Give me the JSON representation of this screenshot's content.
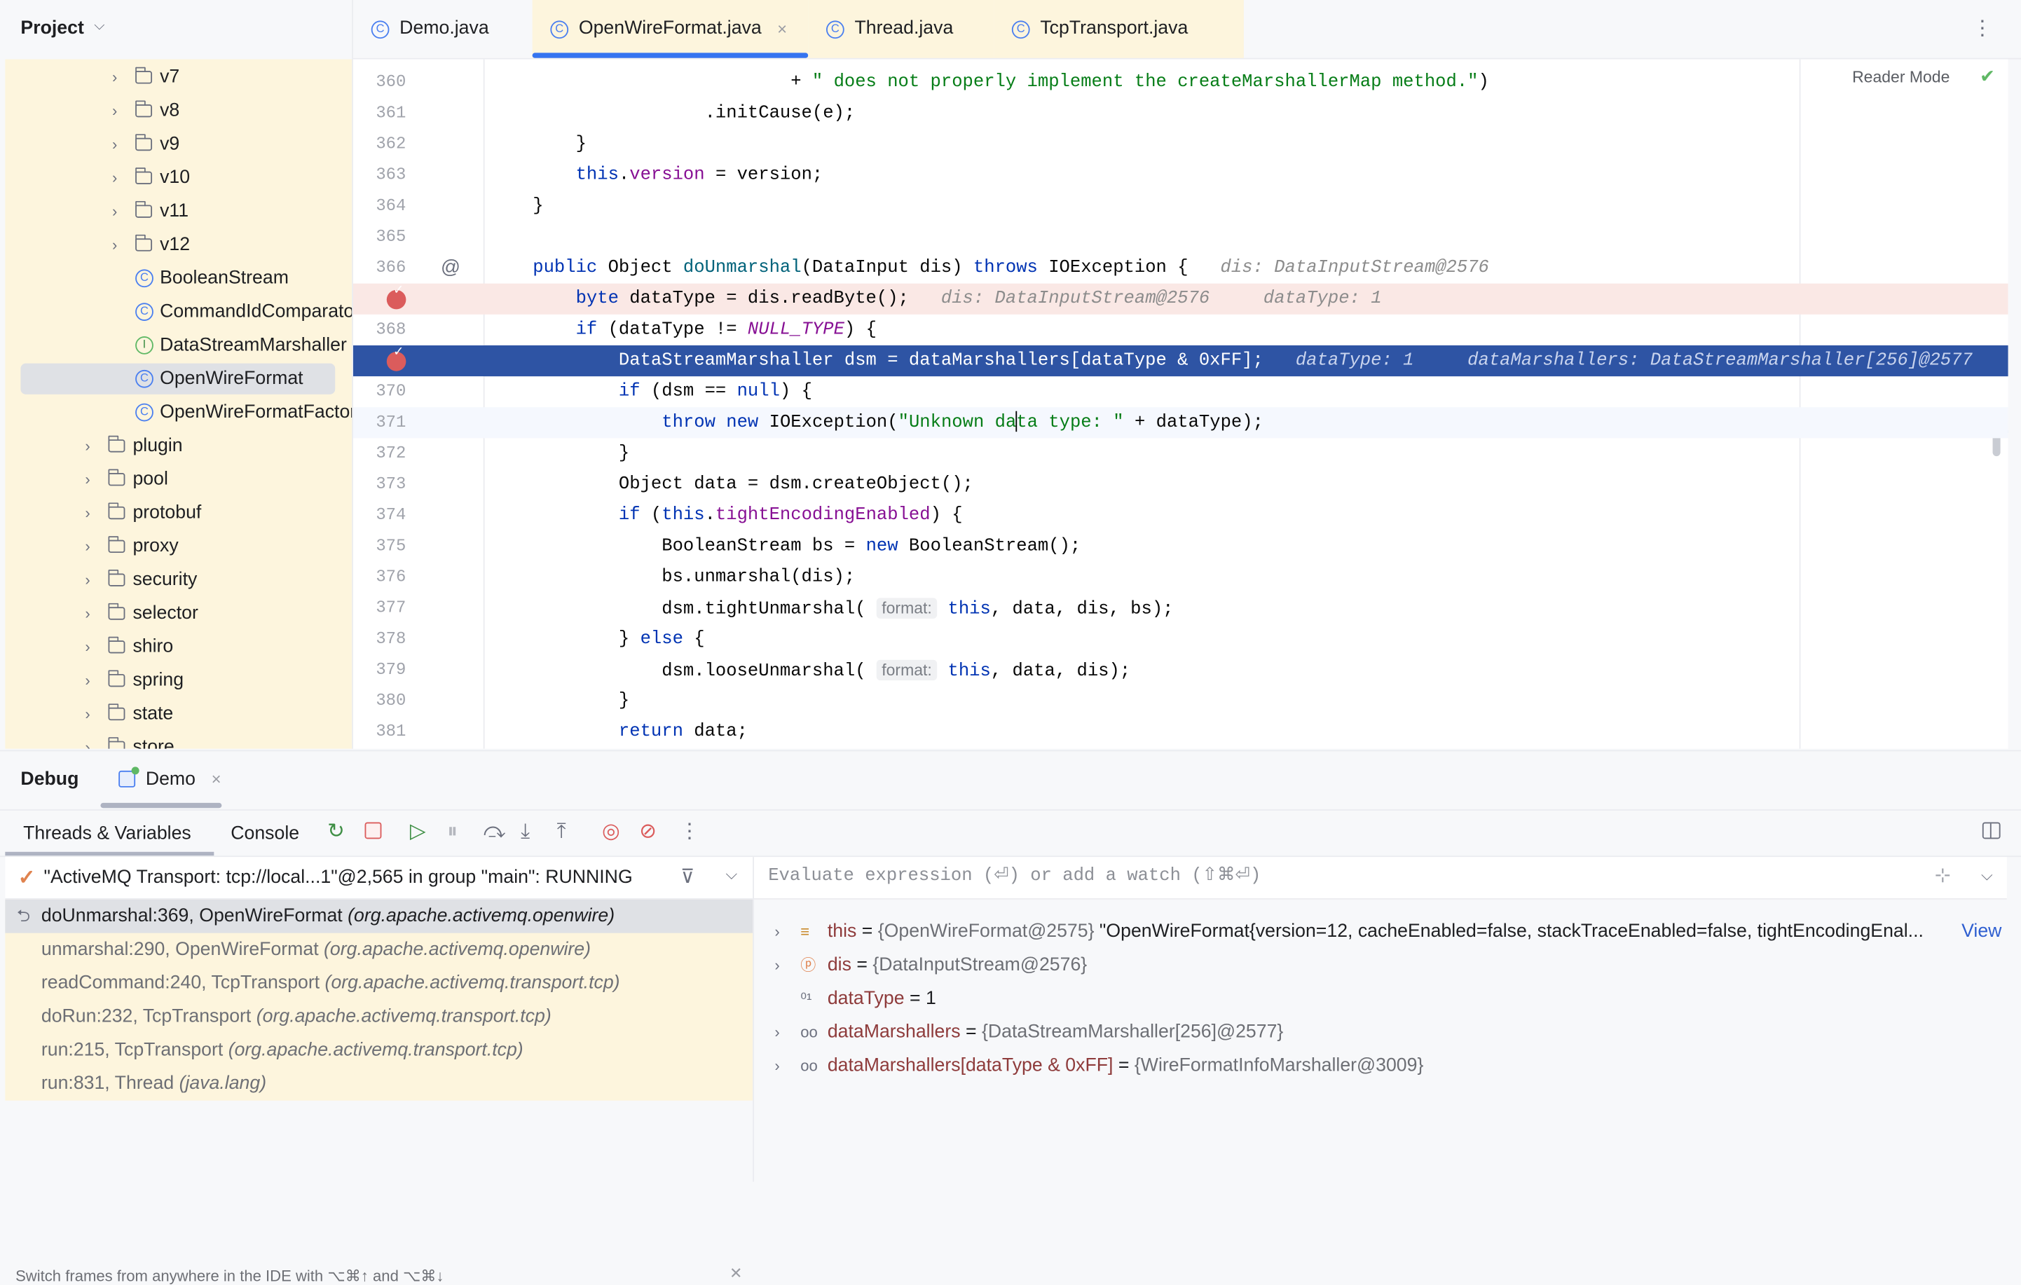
{
  "project": {
    "title": "Project",
    "tree": [
      {
        "depth": 4,
        "type": "folder",
        "label": "v7",
        "chevron": true
      },
      {
        "depth": 4,
        "type": "folder",
        "label": "v8",
        "chevron": true
      },
      {
        "depth": 4,
        "type": "folder",
        "label": "v9",
        "chevron": true
      },
      {
        "depth": 4,
        "type": "folder",
        "label": "v10",
        "chevron": true
      },
      {
        "depth": 4,
        "type": "folder",
        "label": "v11",
        "chevron": true
      },
      {
        "depth": 4,
        "type": "folder",
        "label": "v12",
        "chevron": true
      },
      {
        "depth": 4,
        "type": "class",
        "label": "BooleanStream",
        "chevron": false
      },
      {
        "depth": 4,
        "type": "class",
        "label": "CommandIdComparator",
        "chevron": false
      },
      {
        "depth": 4,
        "type": "interface",
        "label": "DataStreamMarshaller",
        "chevron": false
      },
      {
        "depth": 4,
        "type": "class",
        "label": "OpenWireFormat",
        "chevron": false,
        "selected": true
      },
      {
        "depth": 4,
        "type": "class",
        "label": "OpenWireFormatFactory",
        "chevron": false
      },
      {
        "depth": 3,
        "type": "folder",
        "label": "plugin",
        "chevron": true
      },
      {
        "depth": 3,
        "type": "folder",
        "label": "pool",
        "chevron": true
      },
      {
        "depth": 3,
        "type": "folder",
        "label": "protobuf",
        "chevron": true
      },
      {
        "depth": 3,
        "type": "folder",
        "label": "proxy",
        "chevron": true
      },
      {
        "depth": 3,
        "type": "folder",
        "label": "security",
        "chevron": true
      },
      {
        "depth": 3,
        "type": "folder",
        "label": "selector",
        "chevron": true
      },
      {
        "depth": 3,
        "type": "folder",
        "label": "shiro",
        "chevron": true
      },
      {
        "depth": 3,
        "type": "folder",
        "label": "spring",
        "chevron": true
      },
      {
        "depth": 3,
        "type": "folder",
        "label": "state",
        "chevron": true
      },
      {
        "depth": 3,
        "type": "folder",
        "label": "store",
        "chevron": true
      }
    ]
  },
  "tabs": [
    {
      "label": "Demo.java",
      "active": false
    },
    {
      "label": "OpenWireFormat.java",
      "active": true,
      "close": "×"
    },
    {
      "label": "Thread.java",
      "active": false
    },
    {
      "label": "TcpTransport.java",
      "active": false
    }
  ],
  "editor": {
    "reader_mode": "Reader Mode",
    "lines": [
      {
        "n": "360",
        "tokens": [
          [
            "                            + ",
            ""
          ],
          [
            "\" does not properly implement the createMarshallerMap method.\"",
            "str"
          ],
          [
            ")",
            ""
          ]
        ]
      },
      {
        "n": "361",
        "tokens": [
          [
            "                    .initCause(e);",
            ""
          ]
        ]
      },
      {
        "n": "362",
        "tokens": [
          [
            "        }",
            ""
          ]
        ]
      },
      {
        "n": "363",
        "tokens": [
          [
            "        ",
            ""
          ],
          [
            "this",
            "kw"
          ],
          [
            ".",
            ""
          ],
          [
            "version",
            "fld"
          ],
          [
            " = version;",
            ""
          ]
        ]
      },
      {
        "n": "364",
        "tokens": [
          [
            "    }",
            ""
          ]
        ]
      },
      {
        "n": "365",
        "tokens": []
      },
      {
        "n": "366",
        "marker": "@",
        "tokens": [
          [
            "    ",
            ""
          ],
          [
            "public",
            "kw"
          ],
          [
            " Object ",
            ""
          ],
          [
            "doUnmarshal",
            "fn"
          ],
          [
            "(DataInput dis) ",
            ""
          ],
          [
            "throws",
            "kw"
          ],
          [
            " IOException {   ",
            ""
          ],
          [
            "dis: DataInputStream@2576",
            "hint"
          ]
        ]
      },
      {
        "n": "367",
        "breakpoint": true,
        "state": "bp",
        "tokens": [
          [
            "        ",
            ""
          ],
          [
            "byte",
            "kw"
          ],
          [
            " dataType = dis.readByte();   ",
            ""
          ],
          [
            "dis: DataInputStream@2576",
            "hint"
          ],
          [
            "     ",
            ""
          ],
          [
            "dataType: 1",
            "hint"
          ]
        ]
      },
      {
        "n": "368",
        "tokens": [
          [
            "        ",
            ""
          ],
          [
            "if",
            "kw"
          ],
          [
            " (dataType != ",
            ""
          ],
          [
            "NULL_TYPE",
            "cst"
          ],
          [
            ") {",
            ""
          ]
        ]
      },
      {
        "n": "369",
        "breakpoint": true,
        "state": "exec",
        "tokens": [
          [
            "            DataStreamMarshaller dsm = dataMarshallers[dataType & 0xFF];   ",
            ""
          ],
          [
            "dataType: 1",
            "hint"
          ],
          [
            "     ",
            ""
          ],
          [
            "dataMarshallers: DataStreamMarshaller[256]@2577",
            "hint"
          ]
        ]
      },
      {
        "n": "370",
        "tokens": [
          [
            "            ",
            ""
          ],
          [
            "if",
            "kw"
          ],
          [
            " (dsm == ",
            ""
          ],
          [
            "null",
            "kw"
          ],
          [
            ") {",
            ""
          ]
        ]
      },
      {
        "n": "371",
        "state": "caret",
        "tokens": [
          [
            "                ",
            ""
          ],
          [
            "throw",
            "kw"
          ],
          [
            " ",
            ""
          ],
          [
            "new",
            "kw"
          ],
          [
            " IOException(",
            ""
          ],
          [
            "\"Unknown da",
            "str"
          ],
          [
            "|",
            "caret"
          ],
          [
            "ta type: \"",
            "str"
          ],
          [
            " + dataType);",
            ""
          ]
        ]
      },
      {
        "n": "372",
        "tokens": [
          [
            "            }",
            ""
          ]
        ]
      },
      {
        "n": "373",
        "tokens": [
          [
            "            Object data = dsm.createObject();",
            ""
          ]
        ]
      },
      {
        "n": "374",
        "tokens": [
          [
            "            ",
            ""
          ],
          [
            "if",
            "kw"
          ],
          [
            " (",
            ""
          ],
          [
            "this",
            "kw"
          ],
          [
            ".",
            ""
          ],
          [
            "tightEncodingEnabled",
            "fld"
          ],
          [
            ") {",
            ""
          ]
        ]
      },
      {
        "n": "375",
        "tokens": [
          [
            "                BooleanStream bs = ",
            ""
          ],
          [
            "new",
            "kw"
          ],
          [
            " BooleanStream();",
            ""
          ]
        ]
      },
      {
        "n": "376",
        "tokens": [
          [
            "                bs.unmarshal(dis);",
            ""
          ]
        ]
      },
      {
        "n": "377",
        "tokens": [
          [
            "                dsm.tightUnmarshal( ",
            ""
          ],
          [
            "format:",
            "phint"
          ],
          [
            " ",
            ""
          ],
          [
            "this",
            "kw"
          ],
          [
            ", data, dis, bs);",
            ""
          ]
        ]
      },
      {
        "n": "378",
        "tokens": [
          [
            "            } ",
            ""
          ],
          [
            "else",
            "kw"
          ],
          [
            " {",
            ""
          ]
        ]
      },
      {
        "n": "379",
        "tokens": [
          [
            "                dsm.looseUnmarshal( ",
            ""
          ],
          [
            "format:",
            "phint"
          ],
          [
            " ",
            ""
          ],
          [
            "this",
            "kw"
          ],
          [
            ", data, dis);",
            ""
          ]
        ]
      },
      {
        "n": "380",
        "tokens": [
          [
            "            }",
            ""
          ]
        ]
      },
      {
        "n": "381",
        "tokens": [
          [
            "            ",
            ""
          ],
          [
            "return",
            "kw"
          ],
          [
            " data;",
            ""
          ]
        ]
      }
    ]
  },
  "debug": {
    "title": "Debug",
    "session_tab": "Demo",
    "session_close": "×",
    "subtabs": [
      "Threads & Variables",
      "Console"
    ],
    "thread": "\"ActiveMQ Transport: tcp://local...1\"@2,565 in group \"main\": RUNNING",
    "frames": [
      {
        "method": "doUnmarshal:369, OpenWireFormat ",
        "pkg": "(org.apache.activemq.openwire)",
        "current": true
      },
      {
        "method": "unmarshal:290, OpenWireFormat ",
        "pkg": "(org.apache.activemq.openwire)"
      },
      {
        "method": "readCommand:240, TcpTransport ",
        "pkg": "(org.apache.activemq.transport.tcp)"
      },
      {
        "method": "doRun:232, TcpTransport ",
        "pkg": "(org.apache.activemq.transport.tcp)"
      },
      {
        "method": "run:215, TcpTransport ",
        "pkg": "(org.apache.activemq.transport.tcp)"
      },
      {
        "method": "run:831, Thread ",
        "pkg": "(java.lang)"
      }
    ],
    "hint": "Switch frames from anywhere in the IDE with ⌥⌘↑ and ⌥⌘↓",
    "watch_placeholder": "Evaluate expression (⏎) or add a watch (⇧⌘⏎)",
    "variables": [
      {
        "icon": "field-icon",
        "name": "this",
        "eq": " = ",
        "obj": "{OpenWireFormat@2575} ",
        "value": "\"OpenWireFormat{version=12, cacheEnabled=false, stackTraceEnabled=false, tightEncodingEnal...",
        "link": "View",
        "expandable": true
      },
      {
        "icon": "parameter-icon",
        "name": "dis",
        "eq": " = ",
        "obj": "{DataInputStream@2576}",
        "value": "",
        "expandable": true
      },
      {
        "icon": "primitive-icon",
        "name": "dataType",
        "eq": " = ",
        "obj": "",
        "value": "1",
        "expandable": false
      },
      {
        "icon": "watch-icon",
        "name": "dataMarshallers",
        "eq": " = ",
        "obj": "{DataStreamMarshaller[256]@2577}",
        "value": "",
        "expandable": true
      },
      {
        "icon": "watch-icon",
        "name": "dataMarshallers[dataType & 0xFF]",
        "eq": " = ",
        "obj": "{WireFormatInfoMarshaller@3009}",
        "value": "",
        "expandable": true
      }
    ]
  },
  "colors": {
    "accent": "#3574f0",
    "execution_line": "#2e54a4",
    "breakpoint": "#db5c5c",
    "tree_bg": "#fdf5dd"
  }
}
